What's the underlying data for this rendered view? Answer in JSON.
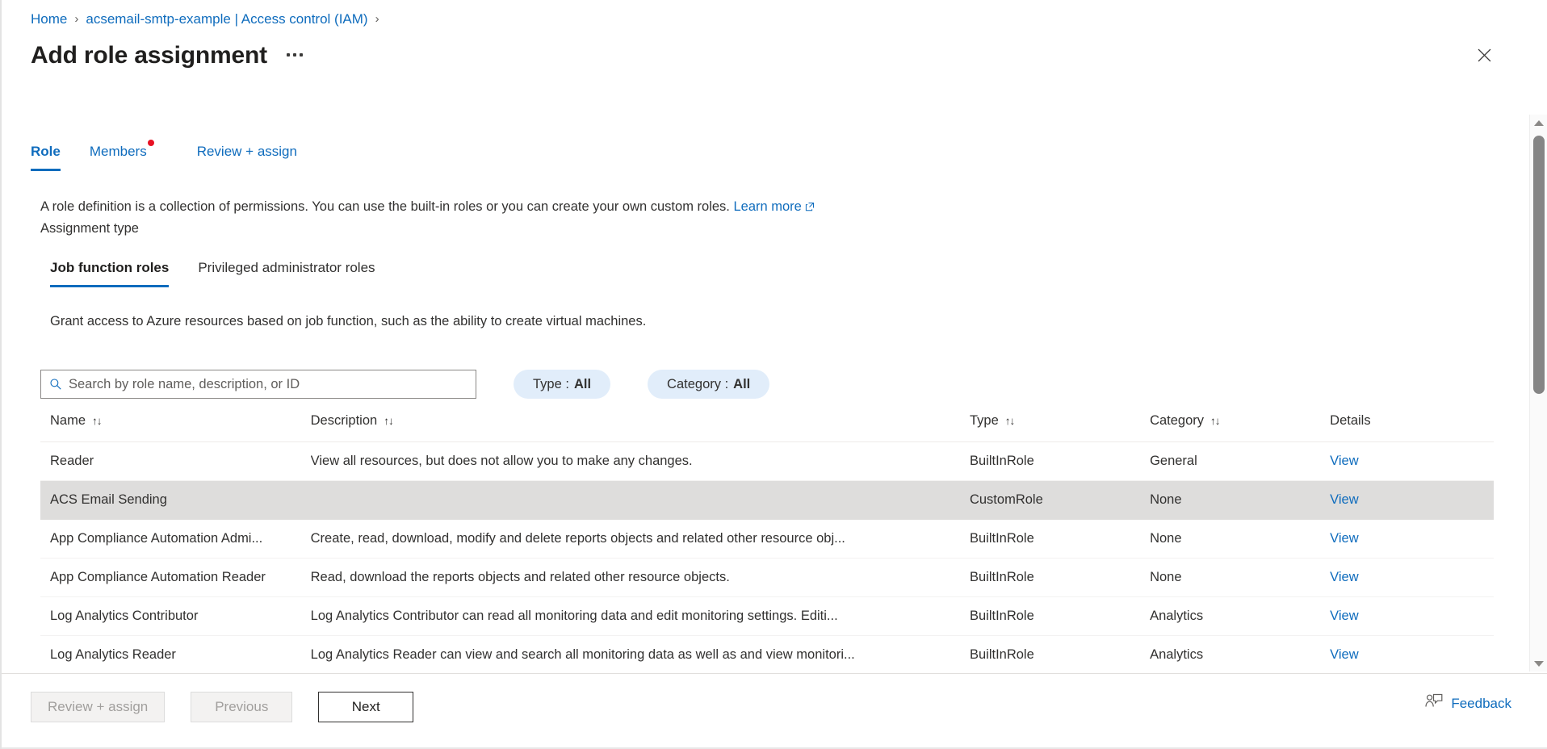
{
  "breadcrumb": {
    "items": [
      {
        "label": "Home"
      },
      {
        "label": "acsemail-smtp-example | Access control (IAM)"
      }
    ],
    "separator": "›"
  },
  "header": {
    "title": "Add role assignment",
    "more_menu": "more-commands",
    "close": "Close"
  },
  "tabs": [
    {
      "label": "Role",
      "active": true,
      "badge": false
    },
    {
      "label": "Members",
      "active": false,
      "badge": true
    },
    {
      "label": "Review + assign",
      "active": false,
      "badge": false
    }
  ],
  "description": {
    "text": "A role definition is a collection of permissions. You can use the built-in roles or you can create your own custom roles.",
    "link_label": "Learn more",
    "assignment_type_label": "Assignment type"
  },
  "subtabs": [
    {
      "label": "Job function roles",
      "active": true
    },
    {
      "label": "Privileged administrator roles",
      "active": false
    }
  ],
  "grant_text": "Grant access to Azure resources based on job function, such as the ability to create virtual machines.",
  "search": {
    "placeholder": "Search by role name, description, or ID",
    "value": ""
  },
  "filters": [
    {
      "label": "Type :",
      "value": "All"
    },
    {
      "label": "Category :",
      "value": "All"
    }
  ],
  "table": {
    "columns": [
      {
        "label": "Name",
        "sortable": true
      },
      {
        "label": "Description",
        "sortable": true
      },
      {
        "label": "Type",
        "sortable": true
      },
      {
        "label": "Category",
        "sortable": true
      },
      {
        "label": "Details",
        "sortable": false
      }
    ],
    "sort_glyph": "↑↓",
    "rows": [
      {
        "name": "Reader",
        "description": "View all resources, but does not allow you to make any changes.",
        "type": "BuiltInRole",
        "category": "General",
        "details": "View",
        "selected": false
      },
      {
        "name": "ACS Email Sending",
        "description": "",
        "type": "CustomRole",
        "category": "None",
        "details": "View",
        "selected": true
      },
      {
        "name": "App Compliance Automation Admi...",
        "description": "Create, read, download, modify and delete reports objects and related other resource obj...",
        "type": "BuiltInRole",
        "category": "None",
        "details": "View",
        "selected": false
      },
      {
        "name": "App Compliance Automation Reader",
        "description": "Read, download the reports objects and related other resource objects.",
        "type": "BuiltInRole",
        "category": "None",
        "details": "View",
        "selected": false
      },
      {
        "name": "Log Analytics Contributor",
        "description": "Log Analytics Contributor can read all monitoring data and edit monitoring settings. Editi...",
        "type": "BuiltInRole",
        "category": "Analytics",
        "details": "View",
        "selected": false
      },
      {
        "name": "Log Analytics Reader",
        "description": "Log Analytics Reader can view and search all monitoring data as well as and view monitori...",
        "type": "BuiltInRole",
        "category": "Analytics",
        "details": "View",
        "selected": false
      }
    ]
  },
  "footer": {
    "buttons": [
      {
        "label": "Review + assign",
        "disabled": true
      },
      {
        "label": "Previous",
        "disabled": true
      },
      {
        "label": "Next",
        "disabled": false
      }
    ],
    "feedback_label": "Feedback"
  },
  "colors": {
    "link": "#0f6cbd",
    "accent": "#0f6cbd",
    "badge": "#e81123",
    "selected_row": "#dedddc",
    "pill_bg": "#e1edfa"
  }
}
